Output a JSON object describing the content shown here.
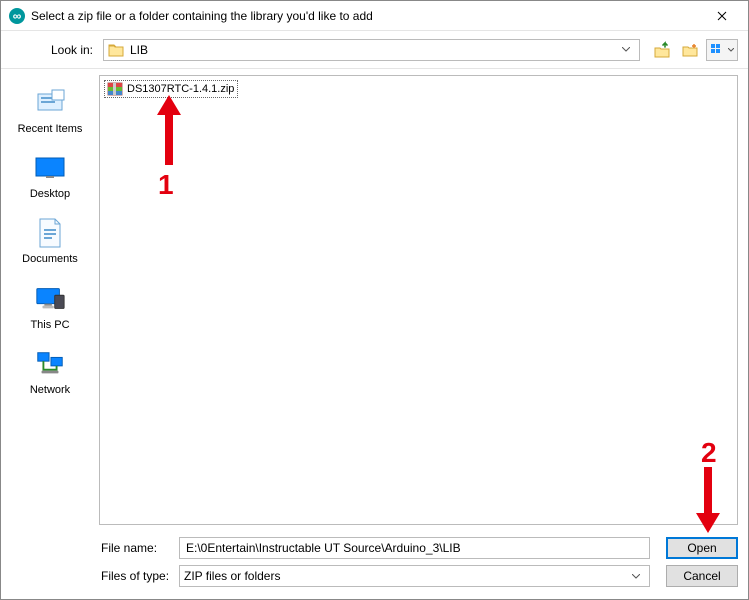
{
  "window": {
    "title": "Select a zip file or a folder containing the library you'd like to add"
  },
  "lookin": {
    "label": "Look in:",
    "current": "LIB"
  },
  "sidebar": {
    "items": [
      {
        "label": "Recent Items"
      },
      {
        "label": "Desktop"
      },
      {
        "label": "Documents"
      },
      {
        "label": "This PC"
      },
      {
        "label": "Network"
      }
    ]
  },
  "files": [
    {
      "name": "DS1307RTC-1.4.1.zip"
    }
  ],
  "form": {
    "filename_label": "File name:",
    "filename_value": "E:\\0Entertain\\Instructable UT Source\\Arduino_3\\LIB",
    "filetype_label": "Files of type:",
    "filetype_value": "ZIP files or folders",
    "open_label": "Open",
    "cancel_label": "Cancel"
  },
  "annotations": {
    "num1": "1",
    "num2": "2"
  },
  "chart_data": null
}
